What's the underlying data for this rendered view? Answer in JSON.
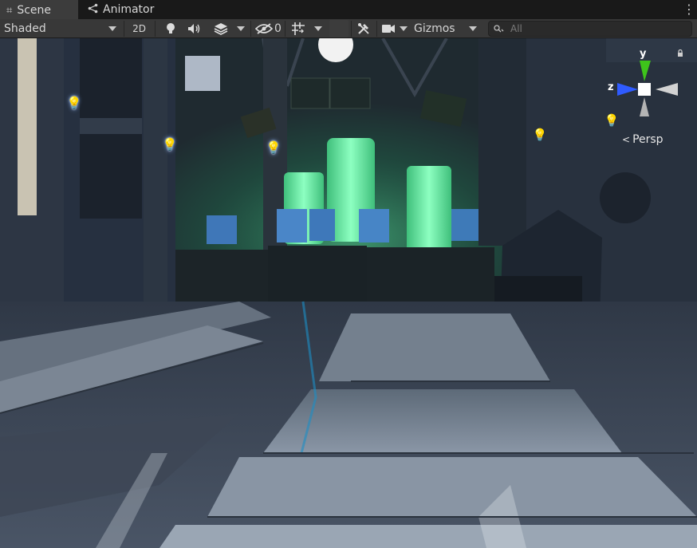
{
  "tabs": [
    {
      "label": "Scene",
      "icon": "grid-icon",
      "active": true
    },
    {
      "label": "Animator",
      "icon": "animator-icon",
      "active": false
    }
  ],
  "toolbar": {
    "draw_mode": "Shaded",
    "toggle_2d": "2D",
    "hidden_count": "0",
    "gizmos_label": "Gizmos",
    "search_placeholder": "All"
  },
  "viewport": {
    "projection_label": "Persp",
    "axes": {
      "y": "y",
      "z": "z"
    },
    "colors": {
      "x_axis": "#d0d0d0",
      "y_axis": "#3ec41b",
      "z_axis": "#2f5bff",
      "glow": "#5bf2a1"
    }
  }
}
